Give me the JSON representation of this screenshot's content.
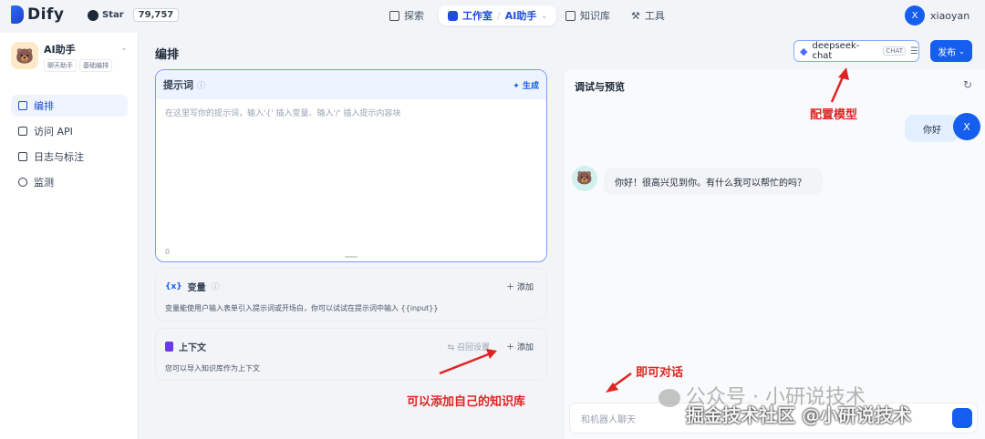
{
  "topbar": {
    "logo_text": "Dify",
    "github_label": "Star",
    "github_count": "79,757",
    "nav": {
      "explore": "探索",
      "studio": "工作室",
      "studio_app": "AI助手",
      "knowledge": "知识库",
      "tools": "工具"
    },
    "user": {
      "initial": "X",
      "name": "xiaoyan"
    }
  },
  "sidebar": {
    "app_name": "AI助手",
    "tags": [
      "聊天助手",
      "基础编排"
    ],
    "items": [
      {
        "label": "编排",
        "active": true
      },
      {
        "label": "访问 API",
        "active": false
      },
      {
        "label": "日志与标注",
        "active": false
      },
      {
        "label": "监测",
        "active": false
      }
    ]
  },
  "main": {
    "title": "编排",
    "model": {
      "name": "deepseek-chat",
      "badge": "CHAT"
    },
    "publish_label": "发布",
    "prompt": {
      "label": "提示词",
      "generate_label": "生成",
      "placeholder": "在这里写你的提示词，输入'{' 插入变量、输入'/' 插入提示内容块",
      "char_count": "0"
    },
    "variables": {
      "label": "变量",
      "add_label": "添加",
      "description": "变量能使用户输入表单引入提示词或开场白，你可以试试在提示词中输入 {{input}}"
    },
    "context": {
      "label": "上下文",
      "recall_label": "召回设置",
      "add_label": "添加",
      "description": "您可以导入知识库作为上下文"
    }
  },
  "debug": {
    "title": "调试与预览",
    "user_message": "你好",
    "user_initial": "X",
    "bot_message": "你好！很高兴见到你。有什么我可以帮忙的吗？",
    "input_placeholder": "和机器人聊天"
  },
  "annotations": {
    "model": "配置模型",
    "chat": "即可对话",
    "knowledge": "可以添加自己的知识库",
    "watermark_1": "公众号 · 小研说技术",
    "watermark_2": "掘金技术社区 @小研说技术"
  },
  "colors": {
    "accent": "#155eef",
    "annotation": "#e02424"
  }
}
